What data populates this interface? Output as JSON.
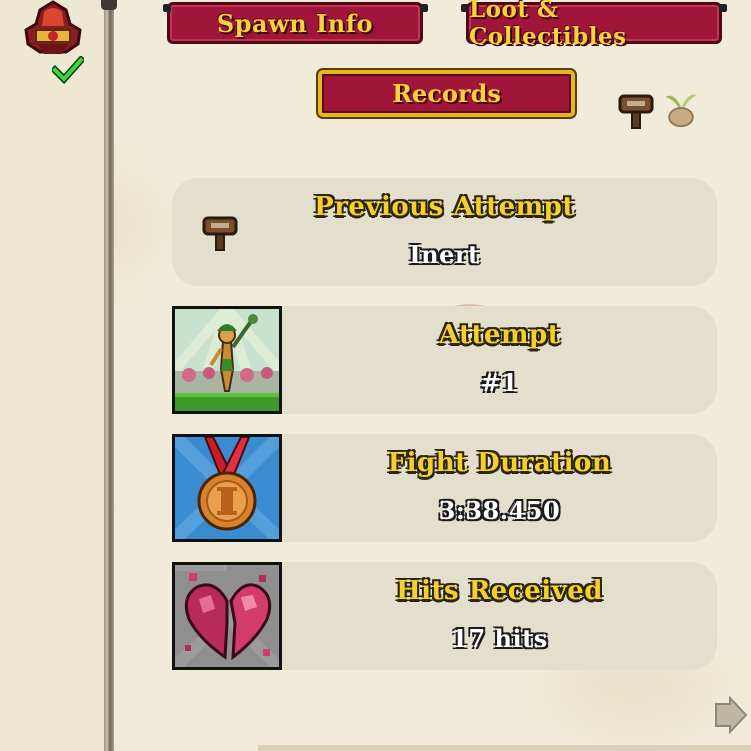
{
  "tabs": {
    "spawn_info": "Spawn Info",
    "loot_collectibles": "Loot & Collectibles",
    "records": "Records"
  },
  "records": [
    {
      "id": "previous-attempt",
      "title": "Previous Attempt",
      "value": "Inert",
      "icon": "signpost-icon"
    },
    {
      "id": "attempt",
      "title": "Attempt",
      "value": "#1",
      "icon": "boss-portrait"
    },
    {
      "id": "fight-duration",
      "title": "Fight Duration",
      "value": "3:38.450",
      "icon": "bronze-medal-icon"
    },
    {
      "id": "hits-received",
      "title": "Hits Received",
      "value": "17 hits",
      "icon": "broken-heart-icon"
    }
  ],
  "colors": {
    "tab_bg": "#a0163a",
    "tab_text": "#f6d23e",
    "panel_bg": "#e3dfcc",
    "page_bg": "#f1ecd9",
    "title_text": "#f4cf2d"
  }
}
